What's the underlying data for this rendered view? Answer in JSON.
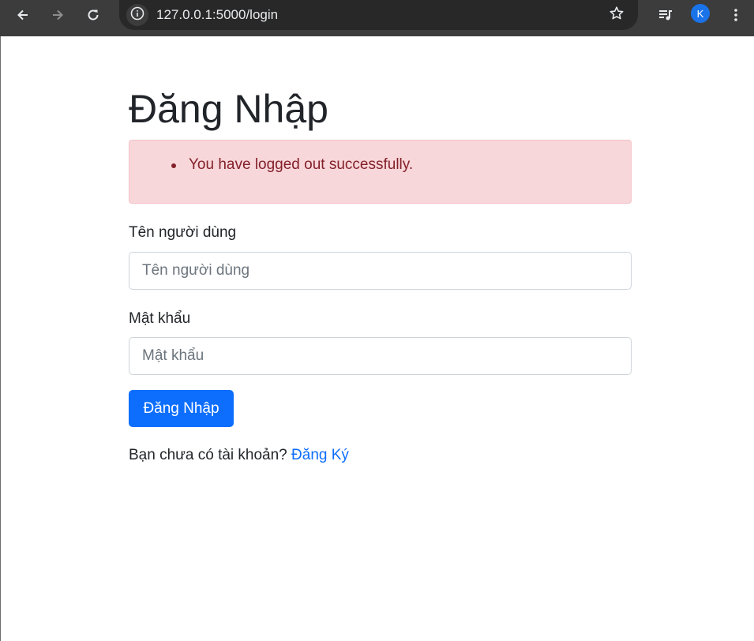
{
  "browser": {
    "url": "127.0.0.1:5000/login",
    "profile_initial": "K",
    "accent_color": "#1a73e8"
  },
  "icons": {
    "back": "back-arrow-icon",
    "forward": "forward-arrow-icon",
    "reload": "reload-icon",
    "site_info": "info-icon",
    "bookmark": "star-icon",
    "media": "media-playlist-icon",
    "menu": "kebab-menu-icon"
  },
  "page": {
    "title": "Đăng Nhập",
    "alert": {
      "messages": [
        "You have logged out successfully."
      ],
      "color": "#f8d7da"
    },
    "form": {
      "username_label": "Tên người dùng",
      "username_placeholder": "Tên người dùng",
      "username_value": "",
      "password_label": "Mật khẩu",
      "password_placeholder": "Mật khẩu",
      "password_value": "",
      "submit_label": "Đăng Nhập",
      "submit_color": "#0d6efd"
    },
    "footer": {
      "prompt": "Bạn chưa có tài khoản? ",
      "register_link": "Đăng Ký"
    }
  }
}
